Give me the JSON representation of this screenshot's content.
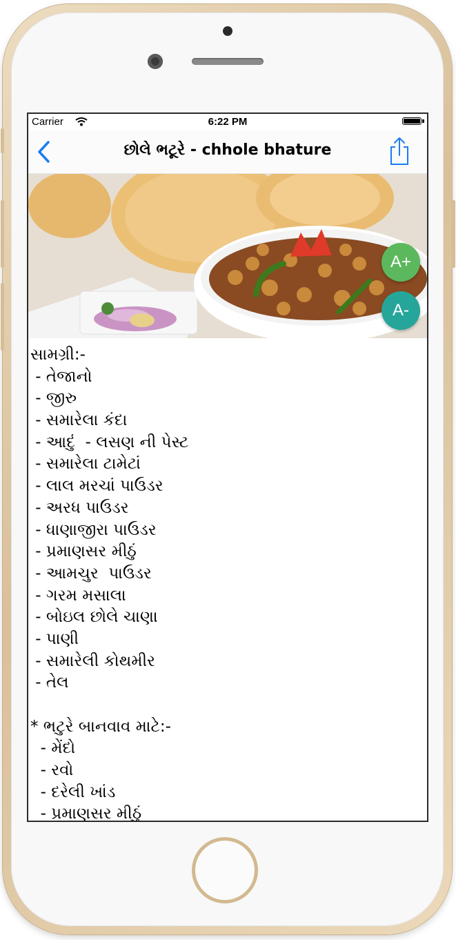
{
  "status_bar": {
    "carrier": "Carrier",
    "time": "6:22 PM",
    "wifi_icon": "wifi-icon",
    "battery_icon": "battery-icon"
  },
  "nav": {
    "title": "છોલે ભટૂરે  - chhole bhature",
    "back_icon": "chevron-left-icon",
    "share_icon": "share-icon",
    "accent_color": "#1a7cf5"
  },
  "actions": {
    "increase_font": "A+",
    "decrease_font": "A-",
    "save_icon": "tray-download-icon",
    "colors": {
      "increase": "#5cb85c",
      "decrease": "#26a69a",
      "save": "#7e57c2"
    }
  },
  "recipe": {
    "lines": [
      "સામગ્રી:-",
      " - તેજાનો",
      " - જીરુ",
      " - સમારેલા કંદા",
      " - આદું  - લસણ ની પેસ્ટ",
      " - સમારેલા ટામેટાં",
      " - લાલ મરચાં પાઉડર",
      " - અરધ પાઉડર",
      " - ધાણાજીરા પાઉડર",
      " - પ્રમાણસર મીઠું",
      " - આમચુર  પાઉડર",
      " - ગરમ મસાલા",
      " - બોઇલ છોલે ચાણા",
      " - પાણી",
      " - સમારેલી કોથમીર",
      " - તેલ",
      "",
      "* ભટુરે બાનવાવ માટે:-",
      "  - મેંદો",
      "  - રવો",
      "  - દરેલી ખાંડ",
      "  - પ્રમાણસર મીઠું"
    ]
  }
}
